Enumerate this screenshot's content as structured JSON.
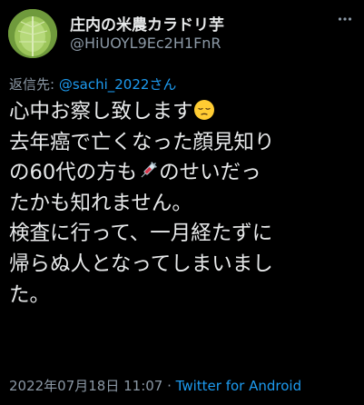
{
  "author": {
    "display_name": "庄内の米農カラドリ芋",
    "handle": "@HiUOYL9Ec2H1FnR"
  },
  "reply": {
    "prefix": "返信先: ",
    "to_user": "@sachi_2022さん"
  },
  "tweet": {
    "line1": "心中お察し致します",
    "line1_emoji": "pensive-face",
    "line2": "去年癌で亡くなった顔見知り",
    "line3_before": "の60代の方も",
    "line3_emoji": "syringe",
    "line3_after": "のせいだっ",
    "line4": "たかも知れません。",
    "line5": "検査に行って、一月経たずに",
    "line6": "帰らぬ人となってしまいまし",
    "line7": "た。"
  },
  "footer": {
    "timestamp": "2022年07月18日 11:07",
    "separator": " · ",
    "source": "Twitter for Android"
  },
  "colors": {
    "background": "#000000",
    "text": "#e7e9ea",
    "secondary": "#8b98a5",
    "link": "#1d9bf0"
  }
}
